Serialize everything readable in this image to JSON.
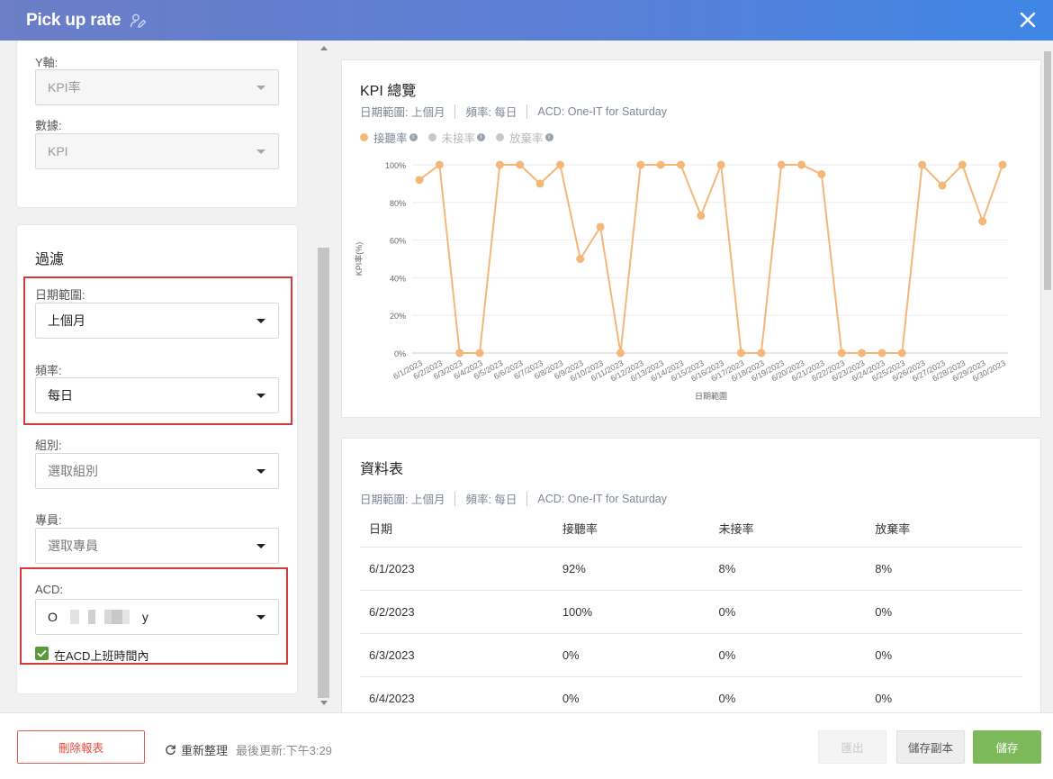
{
  "header": {
    "title": "Pick up rate"
  },
  "left": {
    "yaxis": {
      "label": "Y軸:",
      "value": "KPI率"
    },
    "data_field": {
      "label": "數據:",
      "value": "KPI"
    },
    "filter": {
      "title": "過濾",
      "date_range": {
        "label": "日期範圍:",
        "value": "上個月"
      },
      "frequency": {
        "label": "頻率:",
        "value": "每日"
      },
      "group": {
        "label": "組別:",
        "placeholder": "選取組別"
      },
      "agent": {
        "label": "專員:",
        "placeholder": "選取專員"
      },
      "acd": {
        "label": "ACD:",
        "value_start": "O",
        "value_end": "y",
        "checkbox_label": "在ACD上班時間內",
        "checked": true
      }
    }
  },
  "chart_card": {
    "title": "KPI 總覽",
    "meta": {
      "date_range": "日期範圍: 上個月",
      "frequency": "頻率: 每日",
      "acd": "ACD: One-IT for Saturday"
    },
    "legend": [
      {
        "label": "接聽率",
        "color": "#f4b77a",
        "active": true
      },
      {
        "label": "未接率",
        "color": "#c8c8c8",
        "active": false
      },
      {
        "label": "放棄率",
        "color": "#c8c8c8",
        "active": false
      }
    ]
  },
  "chart_data": {
    "type": "line",
    "xlabel": "日期範圍",
    "ylabel": "KPI率(%)",
    "ylim": [
      0,
      100
    ],
    "yticks": [
      "0%",
      "20%",
      "40%",
      "60%",
      "80%",
      "100%"
    ],
    "x": [
      "6/1/2023",
      "6/2/2023",
      "6/3/2023",
      "6/4/2023",
      "6/5/2023",
      "6/6/2023",
      "6/7/2023",
      "6/8/2023",
      "6/9/2023",
      "6/10/2023",
      "6/11/2023",
      "6/12/2023",
      "6/13/2023",
      "6/14/2023",
      "6/15/2023",
      "6/16/2023",
      "6/17/2023",
      "6/18/2023",
      "6/19/2023",
      "6/20/2023",
      "6/21/2023",
      "6/22/2023",
      "6/23/2023",
      "6/24/2023",
      "6/25/2023",
      "6/26/2023",
      "6/27/2023",
      "6/28/2023",
      "6/29/2023",
      "6/30/2023"
    ],
    "series": [
      {
        "name": "接聽率",
        "color": "#f4b77a",
        "values": [
          92,
          100,
          0,
          0,
          100,
          100,
          90,
          100,
          50,
          67,
          0,
          100,
          100,
          100,
          73,
          100,
          0,
          0,
          100,
          100,
          95,
          0,
          0,
          0,
          0,
          100,
          89,
          100,
          70,
          100
        ]
      }
    ],
    "grid": true,
    "legend_position": "top-left"
  },
  "table_card": {
    "title": "資料表",
    "meta": {
      "date_range": "日期範圍: 上個月",
      "frequency": "頻率: 每日",
      "acd": "ACD: One-IT for Saturday"
    },
    "columns": [
      "日期",
      "接聽率",
      "未接率",
      "放棄率"
    ],
    "rows": [
      [
        "6/1/2023",
        "92%",
        "8%",
        "8%"
      ],
      [
        "6/2/2023",
        "100%",
        "0%",
        "0%"
      ],
      [
        "6/3/2023",
        "0%",
        "0%",
        "0%"
      ],
      [
        "6/4/2023",
        "0%",
        "0%",
        "0%"
      ]
    ]
  },
  "footer": {
    "delete": "刪除報表",
    "refresh": "重新整理",
    "last_update": "最後更新:下午3:29",
    "export": "匯出",
    "save_copy": "儲存副本",
    "save": "儲存"
  }
}
